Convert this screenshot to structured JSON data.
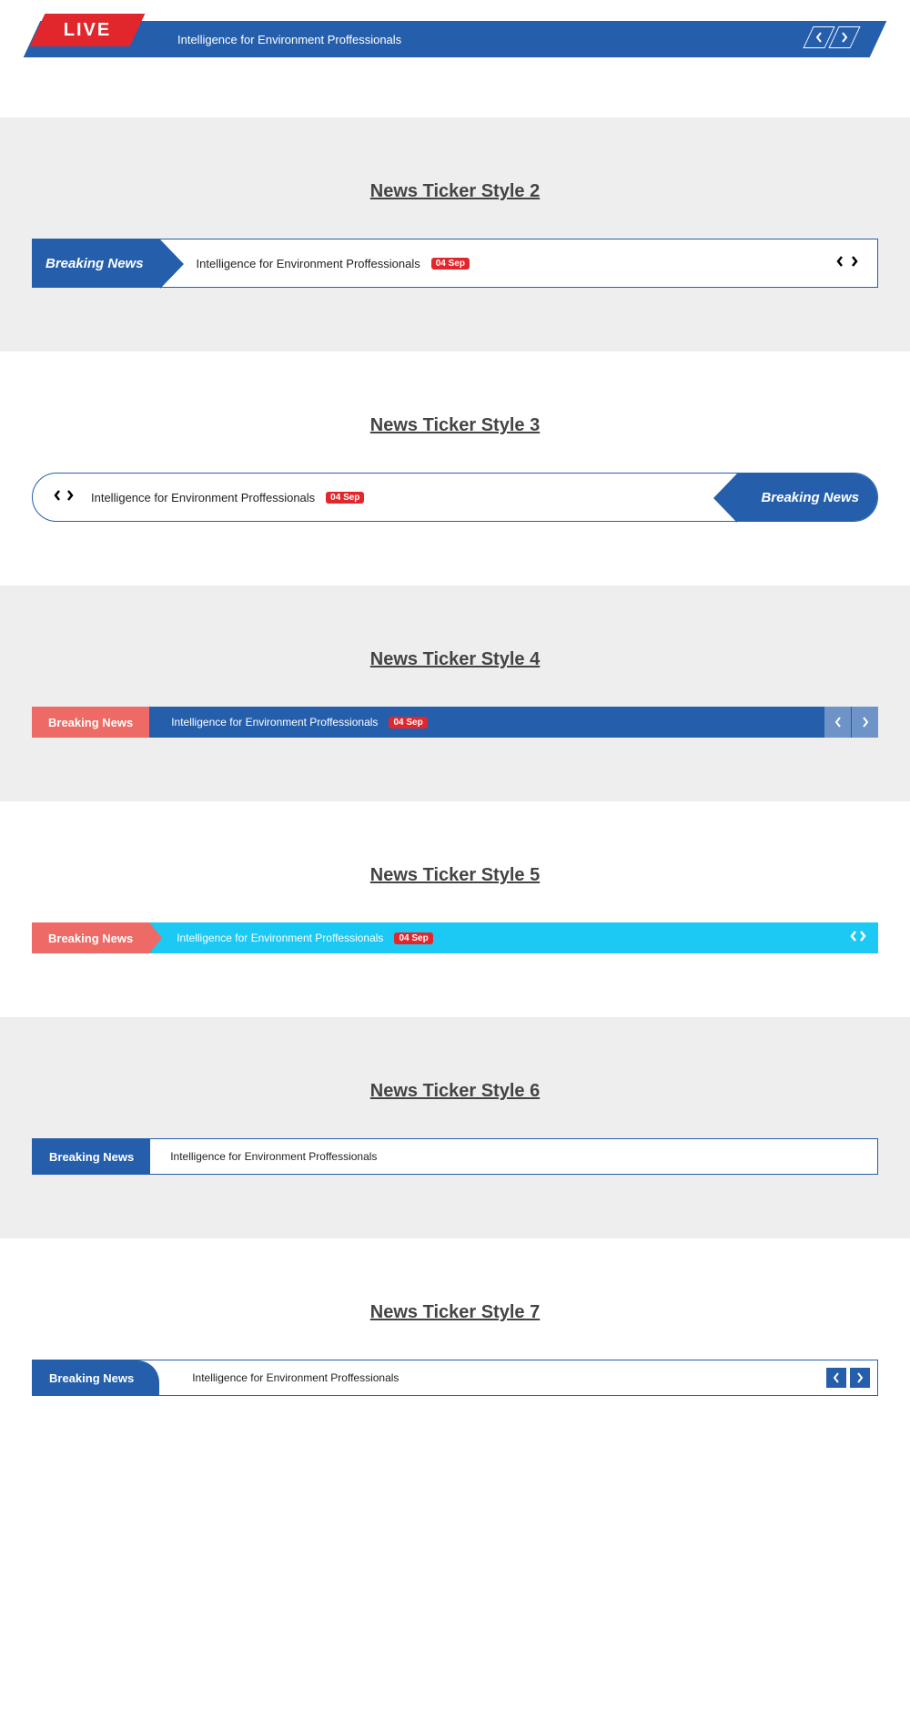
{
  "ticker1": {
    "live_label": "LIVE",
    "text": "Intelligence for Environment Proffessionals"
  },
  "ticker2": {
    "heading": "News Ticker Style 2",
    "label": "Breaking News",
    "text": "Intelligence for Environment Proffessionals",
    "date": "04 Sep"
  },
  "ticker3": {
    "heading": "News Ticker Style 3",
    "label": "Breaking News",
    "text": "Intelligence for Environment Proffessionals",
    "date": "04 Sep"
  },
  "ticker4": {
    "heading": "News Ticker Style 4",
    "label": "Breaking News",
    "text": "Intelligence for Environment Proffessionals",
    "date": "04 Sep"
  },
  "ticker5": {
    "heading": "News Ticker Style 5",
    "label": "Breaking News",
    "text": "Intelligence for Environment Proffessionals",
    "date": "04 Sep"
  },
  "ticker6": {
    "heading": "News Ticker Style 6",
    "label": "Breaking News",
    "text": "Intelligence for Environment Proffessionals"
  },
  "ticker7": {
    "heading": "News Ticker Style 7",
    "label": "Breaking News",
    "text": "Intelligence for Environment Proffessionals"
  }
}
